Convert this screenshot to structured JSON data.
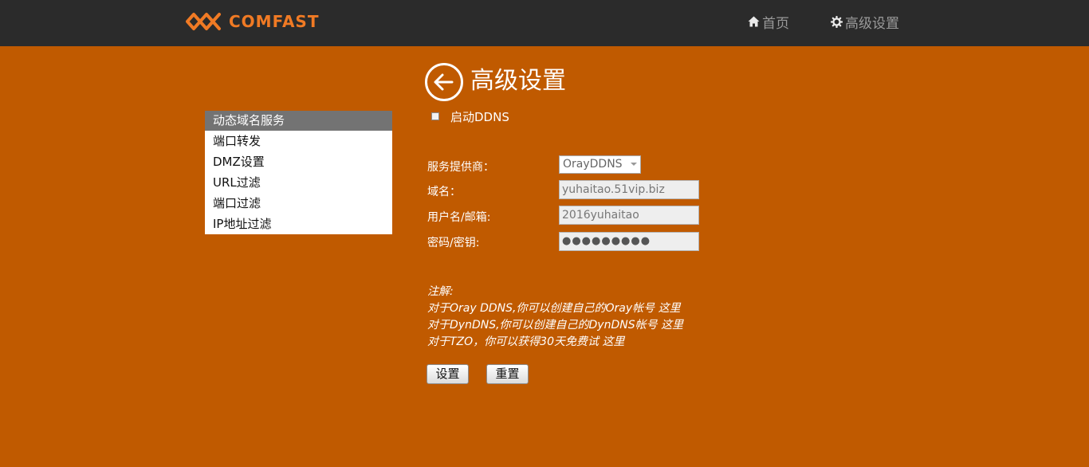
{
  "header": {
    "brand": "COMFAST",
    "nav": [
      {
        "label": "首页",
        "icon": "home-icon"
      },
      {
        "label": "高级设置",
        "icon": "gear-icon"
      }
    ]
  },
  "page": {
    "title": "高级设置"
  },
  "sidebar": {
    "items": [
      {
        "label": "动态域名服务",
        "active": true
      },
      {
        "label": "端口转发"
      },
      {
        "label": "DMZ设置"
      },
      {
        "label": "URL过滤"
      },
      {
        "label": "端口过滤"
      },
      {
        "label": "IP地址过滤"
      }
    ]
  },
  "ddns": {
    "enable_label": "启动DDNS",
    "enabled": false
  },
  "form": {
    "provider_label": "服务提供商：",
    "provider_value": "OrayDDNS",
    "domain_label": "域名：",
    "domain_value": "yuhaitao.51vip.biz",
    "username_label": "用户名/邮箱:",
    "username_value": "2016yuhaitao",
    "password_label": "密码/密钥:",
    "password_value": "●●●●●●●●●"
  },
  "notes": {
    "heading": "注解:",
    "line1_text": "对于Oray DDNS,你可以创建自己的Oray帐号",
    "line1_link": "这里",
    "line2_text": "对于DynDNS,你可以创建自己的DynDNS帐号",
    "line2_link": "这里",
    "line3_text": "对于TZO，你可以获得30天免费试",
    "line3_link": "这里"
  },
  "buttons": {
    "set_label": "设置",
    "reset_label": "重置"
  },
  "colors": {
    "background": "#c05a00",
    "topbar": "#2b2b2b",
    "brand_accent": "#f07a24",
    "sidebar_active": "#737373"
  }
}
